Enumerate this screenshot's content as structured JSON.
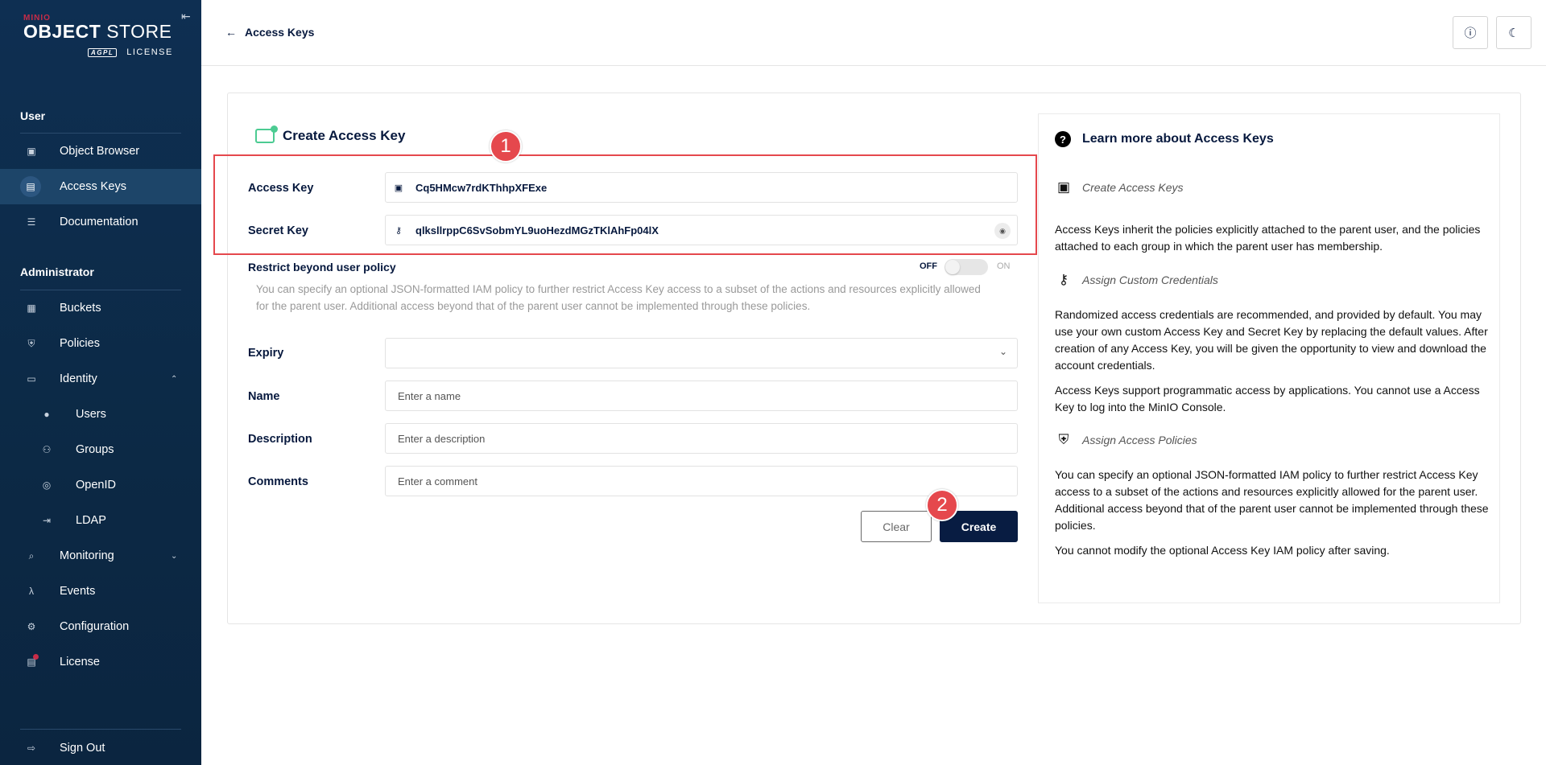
{
  "sidebar": {
    "logo": {
      "brand": "MINIO",
      "product_bold": "OBJECT",
      "product_light": "STORE",
      "badge": "AGPL",
      "license": "LICENSE"
    },
    "sections": [
      {
        "title": "User"
      },
      {
        "title": "Administrator"
      }
    ],
    "items": [
      {
        "label": "Object Browser",
        "icon": "object-browser-icon"
      },
      {
        "label": "Access Keys",
        "icon": "access-keys-icon"
      },
      {
        "label": "Documentation",
        "icon": "documentation-icon"
      },
      {
        "label": "Buckets",
        "icon": "buckets-icon"
      },
      {
        "label": "Policies",
        "icon": "policies-icon"
      },
      {
        "label": "Identity",
        "icon": "identity-icon"
      },
      {
        "label": "Users",
        "icon": "user-icon"
      },
      {
        "label": "Groups",
        "icon": "groups-icon"
      },
      {
        "label": "OpenID",
        "icon": "openid-icon"
      },
      {
        "label": "LDAP",
        "icon": "ldap-icon"
      },
      {
        "label": "Monitoring",
        "icon": "monitoring-icon"
      },
      {
        "label": "Events",
        "icon": "lambda-icon"
      },
      {
        "label": "Configuration",
        "icon": "gear-icon"
      },
      {
        "label": "License",
        "icon": "license-icon"
      },
      {
        "label": "Sign Out",
        "icon": "sign-out-icon"
      }
    ],
    "active_item": "Access Keys"
  },
  "header": {
    "back_label": "Access Keys"
  },
  "form": {
    "title": "Create Access Key",
    "access_key": {
      "label": "Access Key",
      "value": "Cq5HMcw7rdKThhpXFExe"
    },
    "secret_key": {
      "label": "Secret Key",
      "value": "qlksllrppC6SvSobmYL9uoHezdMGzTKlAhFp04lX"
    },
    "restrict": {
      "label": "Restrict beyond user policy",
      "off": "OFF",
      "on": "ON",
      "state": "off",
      "description": "You can specify an optional JSON-formatted IAM policy to further restrict Access Key access to a subset of the actions and resources explicitly allowed for the parent user. Additional access beyond that of the parent user cannot be implemented through these policies."
    },
    "expiry": {
      "label": "Expiry",
      "value": ""
    },
    "name": {
      "label": "Name",
      "placeholder": "Enter a name"
    },
    "description": {
      "label": "Description",
      "placeholder": "Enter a description"
    },
    "comments": {
      "label": "Comments",
      "placeholder": "Enter a comment"
    },
    "clear_label": "Clear",
    "create_label": "Create"
  },
  "help": {
    "title": "Learn more about Access Keys",
    "sections": [
      {
        "heading": "Create Access Keys",
        "paragraphs": [
          "Access Keys inherit the policies explicitly attached to the parent user, and the policies attached to each group in which the parent user has membership."
        ]
      },
      {
        "heading": "Assign Custom Credentials",
        "paragraphs": [
          "Randomized access credentials are recommended, and provided by default. You may use your own custom Access Key and Secret Key by replacing the default values. After creation of any Access Key, you will be given the opportunity to view and download the account credentials.",
          "Access Keys support programmatic access by applications. You cannot use a Access Key to log into the MinIO Console."
        ]
      },
      {
        "heading": "Assign Access Policies",
        "paragraphs": [
          "You can specify an optional JSON-formatted IAM policy to further restrict Access Key access to a subset of the actions and resources explicitly allowed for the parent user. Additional access beyond that of the parent user cannot be implemented through these policies.",
          "You cannot modify the optional Access Key IAM policy after saving."
        ]
      }
    ]
  },
  "annotations": {
    "badge1": "1",
    "badge2": "2",
    "color": "#e5484d"
  }
}
